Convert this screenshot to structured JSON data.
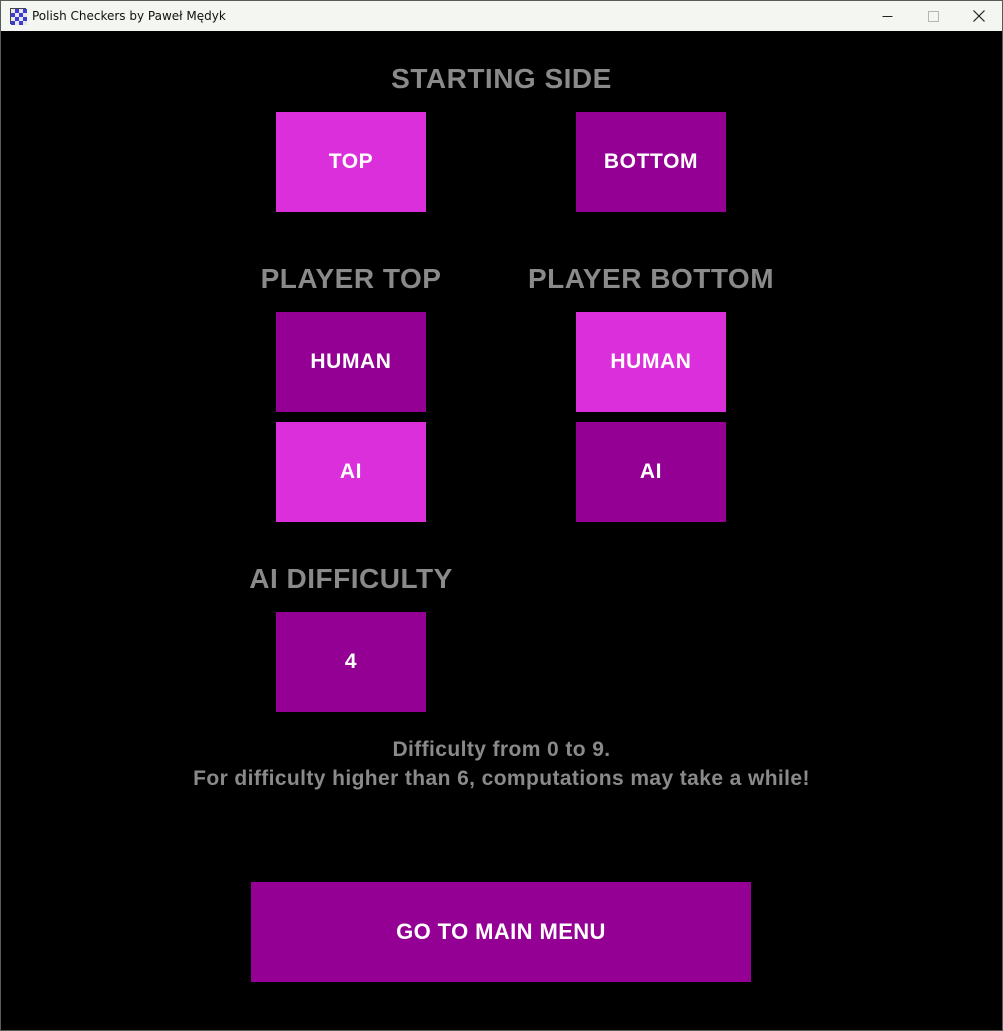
{
  "window": {
    "title": "Polish Checkers by Paweł Mędyk"
  },
  "starting_side": {
    "heading": "STARTING SIDE",
    "top_label": "TOP",
    "bottom_label": "BOTTOM",
    "selected": "TOP"
  },
  "player_top": {
    "heading": "PLAYER TOP",
    "human_label": "HUMAN",
    "ai_label": "AI",
    "selected": "AI"
  },
  "player_bottom": {
    "heading": "PLAYER BOTTOM",
    "human_label": "HUMAN",
    "ai_label": "AI",
    "selected": "HUMAN"
  },
  "ai_difficulty": {
    "heading": "AI DIFFICULTY",
    "value": "4",
    "note_line1": "Difficulty from 0 to 9.",
    "note_line2": "For difficulty higher than 6, computations may take a while!"
  },
  "main_menu_button": "GO TO MAIN MENU",
  "colors": {
    "selected": "#dc2fdc",
    "unselected": "#940094",
    "heading": "#8a8a8a",
    "background": "#000000"
  },
  "icons": [
    "checkerboard-app-icon",
    "minimize-icon",
    "maximize-icon",
    "close-icon"
  ]
}
